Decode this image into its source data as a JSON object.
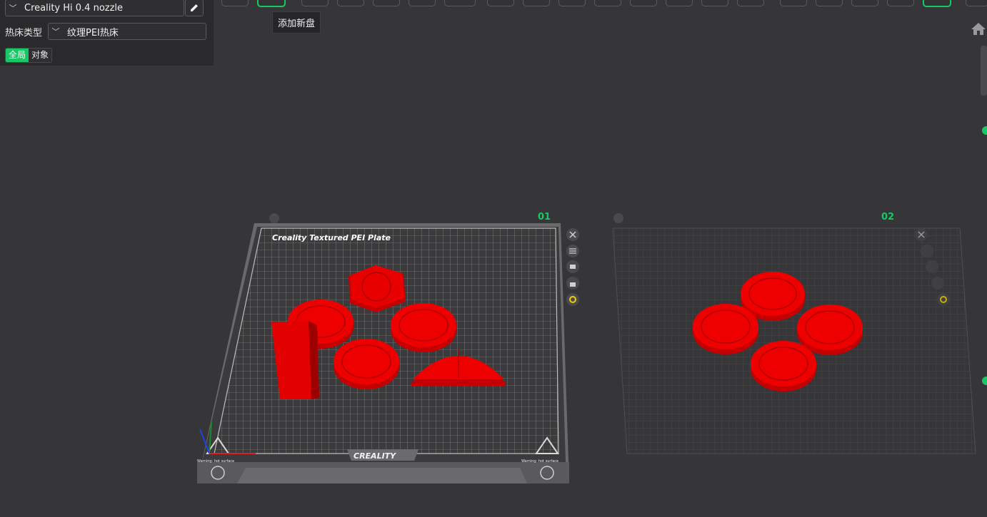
{
  "printer": {
    "name": "Creality Hi 0.4 nozzle"
  },
  "bed": {
    "type_label": "热床类型",
    "type_value": "纹理PEI热床"
  },
  "scope_toggle": {
    "global_label": "全局",
    "object_label": "对象",
    "active": "global"
  },
  "toolbar": {
    "tooltip": "添加新盘",
    "active_tool": "add-plate"
  },
  "plates": [
    {
      "number": "01",
      "bed_title": "Creality Textured PEI Plate",
      "brand": "CREALITY",
      "warning_left": "Warning: hot surface",
      "warning_right": "Warning: hot surface"
    },
    {
      "number": "02"
    }
  ],
  "colors": {
    "accent": "#17c964",
    "model": "#e60000",
    "background": "#363638",
    "panel": "#2a2a2c",
    "highlight": "#f0d000"
  }
}
